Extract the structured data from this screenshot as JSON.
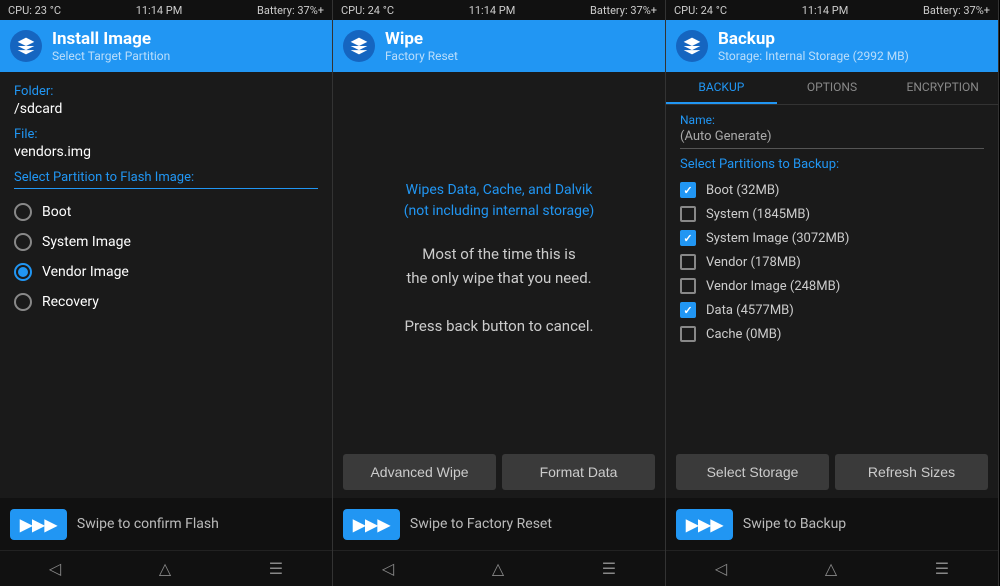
{
  "panels": [
    {
      "id": "install",
      "statusBar": {
        "cpu": "CPU: 23 °C",
        "time": "11:14 PM",
        "battery": "Battery: 37%+"
      },
      "header": {
        "title": "Install Image",
        "subtitle": "Select Target Partition"
      },
      "folder_label": "Folder:",
      "folder_value": "/sdcard",
      "file_label": "File:",
      "file_value": "vendors.img",
      "partition_label": "Select Partition to Flash Image:",
      "partitions": [
        {
          "name": "Boot",
          "selected": false
        },
        {
          "name": "System Image",
          "selected": false
        },
        {
          "name": "Vendor Image",
          "selected": true
        },
        {
          "name": "Recovery",
          "selected": false
        }
      ],
      "swipe_label": "Swipe to confirm Flash"
    },
    {
      "id": "wipe",
      "statusBar": {
        "cpu": "CPU: 24 °C",
        "time": "11:14 PM",
        "battery": "Battery: 37%+"
      },
      "header": {
        "title": "Wipe",
        "subtitle": "Factory Reset"
      },
      "warning_line1": "Wipes Data, Cache, and Dalvik",
      "warning_line2": "(not including internal storage)",
      "main_text_line1": "Most of the time this is",
      "main_text_line2": "the only wipe that you need.",
      "main_text_line3": "Press back button to cancel.",
      "btn_advanced": "Advanced Wipe",
      "btn_format": "Format Data",
      "swipe_label": "Swipe to Factory Reset"
    },
    {
      "id": "backup",
      "statusBar": {
        "cpu": "CPU: 24 °C",
        "time": "11:14 PM",
        "battery": "Battery: 37%+"
      },
      "header": {
        "title": "Backup",
        "subtitle": "Storage: Internal Storage (2992 MB)"
      },
      "tabs": [
        {
          "label": "BACKUP",
          "active": true
        },
        {
          "label": "OPTIONS",
          "active": false
        },
        {
          "label": "ENCRYPTION",
          "active": false
        }
      ],
      "name_label": "Name:",
      "name_value": "(Auto Generate)",
      "partitions_label": "Select Partitions to Backup:",
      "partitions": [
        {
          "name": "Boot (32MB)",
          "checked": true
        },
        {
          "name": "System (1845MB)",
          "checked": false
        },
        {
          "name": "System Image (3072MB)",
          "checked": true
        },
        {
          "name": "Vendor (178MB)",
          "checked": false
        },
        {
          "name": "Vendor Image (248MB)",
          "checked": false
        },
        {
          "name": "Data (4577MB)",
          "checked": true
        },
        {
          "name": "Cache (0MB)",
          "checked": false
        }
      ],
      "btn_storage": "Select Storage",
      "btn_refresh": "Refresh Sizes",
      "swipe_label": "Swipe to Backup"
    }
  ]
}
